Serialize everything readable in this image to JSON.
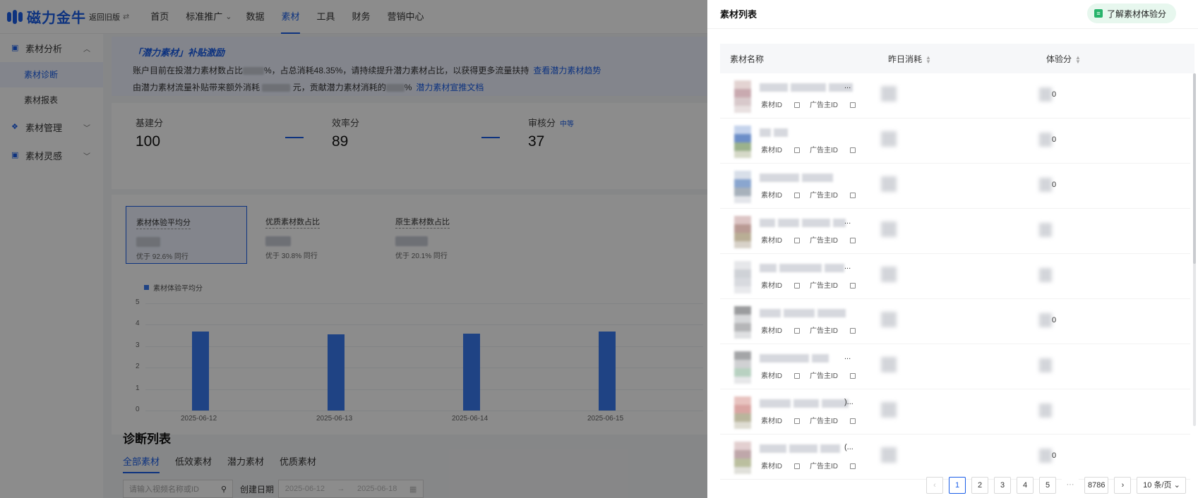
{
  "header": {
    "logo_text": "磁力金牛",
    "back_old": "返回旧版",
    "nav": [
      {
        "label": "首页"
      },
      {
        "label": "标准推广"
      },
      {
        "label": "数据"
      },
      {
        "label": "素材"
      },
      {
        "label": "工具"
      },
      {
        "label": "财务"
      },
      {
        "label": "营销中心"
      }
    ],
    "nav_active_index": 3
  },
  "sidebar": {
    "groups": [
      {
        "label": "素材分析",
        "icon": "chart-icon",
        "expanded": true,
        "items": [
          {
            "label": "素材诊断",
            "active": true
          },
          {
            "label": "素材报表",
            "active": false
          }
        ]
      },
      {
        "label": "素材管理",
        "icon": "grid-icon",
        "expanded": false,
        "items": []
      },
      {
        "label": "素材灵感",
        "icon": "bulb-icon",
        "expanded": false,
        "items": []
      }
    ]
  },
  "promo": {
    "title": "「潜力素材」补贴激励",
    "line1_a": "账户目前在投潜力素材数占比",
    "line1_b": "%，占总消耗48.35%，请持续提升潜力素材占比，以获得更多流量扶持",
    "line1_link": "查看潜力素材趋势",
    "line2_a": "由潜力素材流量补贴带来额外消耗",
    "line2_b": "元，贡献潜力素材消耗的",
    "line2_c": "%",
    "line2_link": "潜力素材宣推文档"
  },
  "scores": [
    {
      "label": "基建分",
      "value": "100",
      "tag": ""
    },
    {
      "label": "效率分",
      "value": "89",
      "tag": ""
    },
    {
      "label": "审核分",
      "value": "37",
      "tag": "中等"
    }
  ],
  "metrics": [
    {
      "label": "素材体验平均分",
      "sub": "优于 92.6% 同行",
      "active": true
    },
    {
      "label": "优质素材数占比",
      "sub": "优于 30.8% 同行",
      "active": false
    },
    {
      "label": "原生素材数占比",
      "sub": "优于 20.1% 同行",
      "active": false
    }
  ],
  "chart_data": {
    "type": "bar",
    "categories": [
      "2025-06-12",
      "2025-06-13",
      "2025-06-14",
      "2025-06-15"
    ],
    "series": [
      {
        "name": "素材体验平均分",
        "values": [
          3.68,
          3.55,
          3.6,
          3.7
        ]
      }
    ],
    "yticks": [
      0,
      1,
      2,
      3,
      4,
      5
    ],
    "ylim": [
      0,
      5
    ],
    "legend_position": "top-left",
    "color": "#3a7bf0"
  },
  "diagnosis": {
    "title": "诊断列表",
    "tabs": [
      "全部素材",
      "低效素材",
      "潜力素材",
      "优质素材"
    ],
    "active_tab": 0,
    "search_placeholder": "请输入视频名称或ID",
    "date_label": "创建日期",
    "date_start": "2025-06-12",
    "date_arrow": "→",
    "date_end": "2025-06-18"
  },
  "drawer": {
    "title": "素材列表",
    "experience_button": "了解素材体验分",
    "columns": [
      "素材名称",
      "昨日消耗",
      "体验分"
    ],
    "id_label": "素材ID",
    "advertiser_label": "广告主ID",
    "rows": [
      {
        "name_tail": "...",
        "score_tail": "0"
      },
      {
        "name_tail": "",
        "score_tail": "0"
      },
      {
        "name_tail": "",
        "score_tail": "0"
      },
      {
        "name_tail": "...",
        "score_tail": ""
      },
      {
        "name_tail": "...",
        "score_tail": ""
      },
      {
        "name_tail": "",
        "score_tail": "0"
      },
      {
        "name_tail": "...",
        "score_tail": ""
      },
      {
        "name_tail": ")...",
        "score_tail": ""
      },
      {
        "name_tail": "(...",
        "score_tail": "0"
      }
    ],
    "pagination": {
      "pages": [
        "1",
        "2",
        "3",
        "4",
        "5"
      ],
      "active": "1",
      "ellipsis": "···",
      "last": "8786",
      "page_size": "10 条/页"
    }
  },
  "colors": {
    "brand": "#1a5ee8",
    "bar": "#3a7bf0",
    "experience_btn_bg": "#e7f7ee"
  }
}
